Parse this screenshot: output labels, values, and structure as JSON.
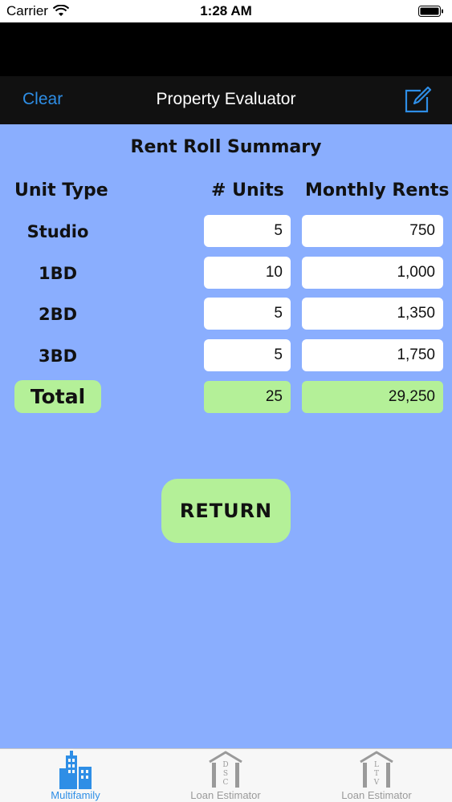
{
  "status_bar": {
    "carrier": "Carrier",
    "time": "1:28 AM"
  },
  "nav": {
    "left_button": "Clear",
    "title": "Property Evaluator",
    "right_icon": "compose-icon"
  },
  "summary": {
    "title": "Rent Roll Summary",
    "headers": {
      "unit_type": "Unit Type",
      "units": "# Units",
      "rents": "Monthly Rents"
    },
    "rows": [
      {
        "label": "Studio",
        "units": "5",
        "rents": "750"
      },
      {
        "label": "1BD",
        "units": "10",
        "rents": "1,000"
      },
      {
        "label": "2BD",
        "units": "5",
        "rents": "1,350"
      },
      {
        "label": "3BD",
        "units": "5",
        "rents": "1,750"
      }
    ],
    "total": {
      "label": "Total",
      "units": "25",
      "rents": "29,250"
    }
  },
  "return_button": "RETURN",
  "tabs": [
    {
      "label": "Multifamily",
      "icon": "buildings-icon",
      "selected": true
    },
    {
      "label": "Loan Estimator",
      "icon": "dsc-house-icon",
      "icon_text": [
        "D",
        "S",
        "C"
      ],
      "selected": false
    },
    {
      "label": "Loan Estimator",
      "icon": "ltv-house-icon",
      "icon_text": [
        "L",
        "T",
        "V"
      ],
      "selected": false
    }
  ],
  "colors": {
    "background": "#8aaefe",
    "accent": "#2e8ee6",
    "highlight": "#b4f098",
    "nav_bg": "#111111"
  }
}
